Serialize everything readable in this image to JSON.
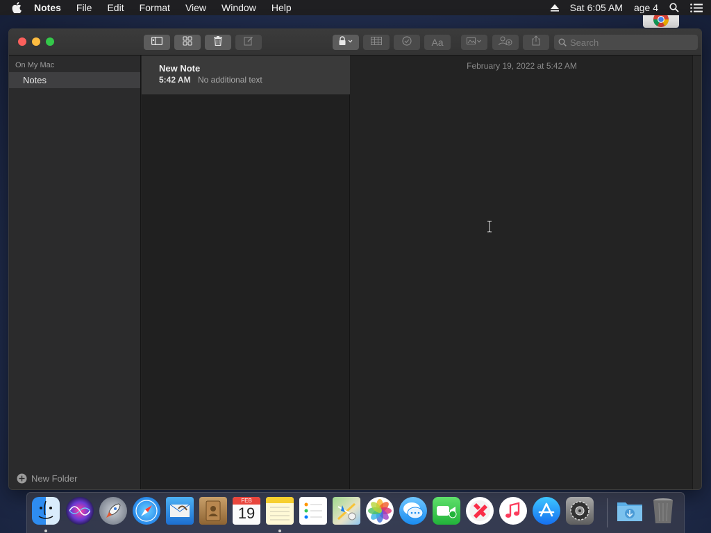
{
  "menubar": {
    "app_name": "Notes",
    "menus": [
      "File",
      "Edit",
      "Format",
      "View",
      "Window",
      "Help"
    ],
    "clock": "Sat 6:05 AM",
    "user": "age 4"
  },
  "window": {
    "search_placeholder": "Search",
    "sidebar": {
      "section_header": "On My Mac",
      "folder": "Notes",
      "new_folder_label": "New Folder"
    },
    "note_list": [
      {
        "title": "New Note",
        "time": "5:42 AM",
        "preview": "No additional text"
      }
    ],
    "editor": {
      "date": "February 19, 2022 at 5:42 AM"
    }
  },
  "dock": {
    "calendar_month": "FEB",
    "calendar_day": "19",
    "apps": [
      "Finder",
      "Siri",
      "Launchpad",
      "Safari",
      "Mail",
      "Contacts",
      "Calendar",
      "Notes",
      "Reminders",
      "Maps",
      "Photos",
      "Messages",
      "FaceTime",
      "News",
      "Music",
      "App Store",
      "System Preferences",
      "Downloads",
      "Trash"
    ]
  }
}
